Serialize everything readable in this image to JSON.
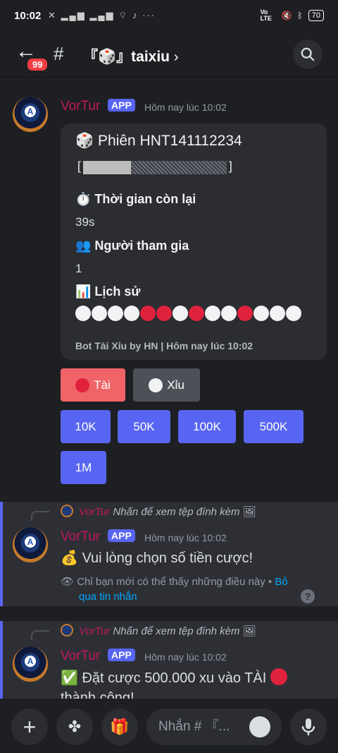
{
  "status": {
    "time": "10:02",
    "left_icons": "✕ ▂▄▆ ▂▄▆ ⌔ ♪ ···",
    "network": "Vo LTE",
    "battery": "70"
  },
  "header": {
    "badge": "99",
    "hash": "#",
    "channel": "『🎲』taixiu",
    "chevron": "›"
  },
  "msg1": {
    "author": "VorTur",
    "app": "APP",
    "timestamp": "Hôm nay lúc 10:02",
    "embed": {
      "title": "🎲 Phiên HNT141112234",
      "bar_left": "[",
      "bar_right": "]",
      "progress": 0.33,
      "time_label": "⏱️ Thời gian còn lại",
      "time_value": "39s",
      "players_label": "👥 Người tham gia",
      "players_value": "1",
      "history_label": "📊 Lịch sử",
      "history": [
        "w",
        "w",
        "w",
        "w",
        "r",
        "r",
        "w",
        "r",
        "w",
        "w",
        "r",
        "w",
        "w",
        "w"
      ],
      "footer": "Bot Tài Xỉu by HN | Hôm nay lúc 10:02"
    },
    "buttons": {
      "tai": "Tài",
      "xiu": "Xỉu",
      "amounts": [
        "10K",
        "50K",
        "100K",
        "500K",
        "1M"
      ]
    }
  },
  "msg2": {
    "reply_author": "VorTur",
    "reply_text": "Nhấn để xem tệp đính kèm",
    "author": "VorTur",
    "app": "APP",
    "timestamp": "Hôm nay lúc 10:02",
    "text": "💰 Vui lòng chọn số tiền cược!",
    "notice": "Chỉ bạn mới có thể thấy những điều này •",
    "notice_link1": "Bỏ",
    "notice_link2": "qua tin nhắn",
    "help": "?"
  },
  "msg3": {
    "reply_author": "VorTur",
    "reply_text": "Nhấn để xem tệp đính kèm",
    "author": "VorTur",
    "app": "APP",
    "timestamp": "Hôm nay lúc 10:02",
    "text": "✅ Đặt cược 500.000 xu vào TÀI",
    "text2": "thành công!"
  },
  "composer": {
    "placeholder": "Nhắn # 『..."
  },
  "colors": {
    "bg": "#1e1f22",
    "embed": "#2b2d31",
    "blurple": "#5865f2",
    "red": "#f06467",
    "username": "#c2185b"
  }
}
